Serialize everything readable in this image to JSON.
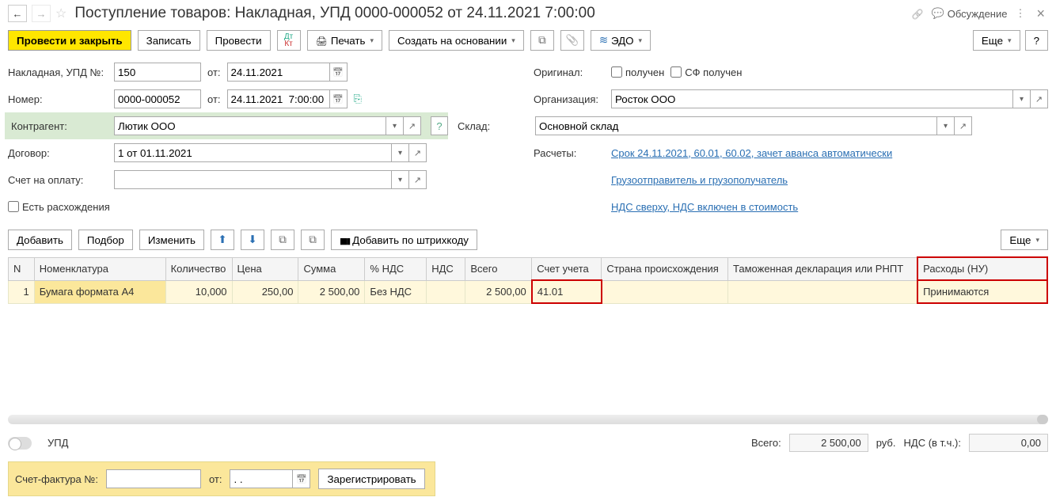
{
  "header": {
    "title": "Поступление товаров: Накладная, УПД 0000-000052 от 24.11.2021 7:00:00",
    "discuss": "Обсуждение"
  },
  "toolbar": {
    "post_close": "Провести и закрыть",
    "write": "Записать",
    "post": "Провести",
    "print": "Печать",
    "create_based": "Создать на основании",
    "edo": "ЭДО",
    "more": "Еще",
    "help": "?"
  },
  "form": {
    "invoice_num_label": "Накладная, УПД №:",
    "invoice_num": "150",
    "from_label": "от:",
    "invoice_date": "24.11.2021",
    "number_label": "Номер:",
    "number": "0000-000052",
    "number_date": "24.11.2021  7:00:00",
    "kontragent_label": "Контрагент:",
    "kontragent": "Лютик ООО",
    "dogovor_label": "Договор:",
    "dogovor": "1 от 01.11.2021",
    "schet_oplatu_label": "Счет на оплату:",
    "schet_oplatu": "",
    "rashod_label": "Есть расхождения",
    "original_label": "Оригинал:",
    "poluchen": "получен",
    "sf_poluchen": "СФ получен",
    "org_label": "Организация:",
    "org": "Росток ООО",
    "sklad_label": "Склад:",
    "sklad": "Основной склад",
    "raschety_label": "Расчеты:",
    "raschety_link": "Срок 24.11.2021, 60.01, 60.02, зачет аванса автоматически",
    "gruzo_link": "Грузоотправитель и грузополучатель",
    "nds_link": "НДС сверху, НДС включен в стоимость"
  },
  "table_toolbar": {
    "add": "Добавить",
    "pick": "Подбор",
    "edit": "Изменить",
    "add_barcode": "Добавить по штрихкоду",
    "more": "Еще"
  },
  "columns": {
    "n": "N",
    "nomen": "Номенклатура",
    "qty": "Количество",
    "price": "Цена",
    "sum": "Сумма",
    "nds_pct": "% НДС",
    "nds": "НДС",
    "total": "Всего",
    "account": "Счет учета",
    "country": "Страна происхождения",
    "customs": "Таможенная декларация или РНПТ",
    "expenses": "Расходы (НУ)"
  },
  "rows": [
    {
      "n": "1",
      "nomen": "Бумага формата А4",
      "qty": "10,000",
      "price": "250,00",
      "sum": "2 500,00",
      "nds_pct": "Без НДС",
      "nds": "",
      "total": "2 500,00",
      "account": "41.01",
      "country": "",
      "customs": "",
      "expenses": "Принимаются"
    }
  ],
  "footer": {
    "upd": "УПД",
    "total_label": "Всего:",
    "total_val": "2 500,00",
    "rub": "руб.",
    "nds_label": "НДС (в т.ч.):",
    "nds_val": "0,00",
    "sf_num_label": "Счет-фактура №:",
    "sf_from": "от:",
    "sf_date": ". . ",
    "register": "Зарегистрировать"
  }
}
